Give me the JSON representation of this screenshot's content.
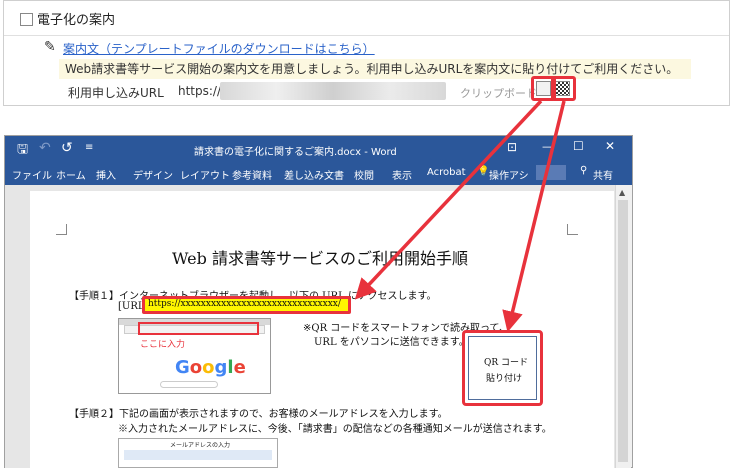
{
  "panel": {
    "section_title": "電子化の案内",
    "template_link": "案内文（テンプレートファイルのダウンロードはこちら）",
    "notice": "Web請求書等サービス開始の案内文を用意しましょう。利用申し込みURLを案内文に貼り付けてご利用ください。",
    "url_label": "利用申し込みURL",
    "url_prefix": "https://",
    "clipboard_label": "クリップボード"
  },
  "word": {
    "qat": {
      "save": "🖫",
      "undo": "↶",
      "redo": "↺",
      "more": "≡"
    },
    "title": "請求書の電子化に関するご案内.docx - Word",
    "window": {
      "ribbon_options": "⊡",
      "minimize": "—",
      "maximize": "☐",
      "close": "✕"
    },
    "menu": [
      "ファイル",
      "ホーム",
      "挿入",
      "デザイン",
      "レイアウト",
      "参考資料",
      "差し込み文書",
      "校閲",
      "表示",
      "Acrobat",
      "操作アシ"
    ],
    "share": "共有"
  },
  "doc": {
    "heading": "Web 請求書等サービスのご利用開始手順",
    "step1": "【手順１】インターネットブラウザーを起動し、以下の URL にアクセスします。",
    "url_prefix": "[URL]",
    "url_text": "https://xxxxxxxxxxxxxxxxxxxxxxxxxxxxxxx/",
    "enter_here": "ここに入力",
    "google": [
      "G",
      "o",
      "o",
      "g",
      "l",
      "e"
    ],
    "qr_note1": "※QR コードをスマートフォンで読み取って、",
    "qr_note2": "URL をパソコンに送信できます。",
    "qr_label1": "QR コード",
    "qr_label2": "貼り付け",
    "step2": "【手順２】下記の画面が表示されますので、お客様のメールアドレスを入力します。",
    "step2_note": "※入力されたメールアドレスに、今後、「請求書」の配信などの各種通知メールが送信されます。",
    "form_title": "メールアドレスの入力"
  },
  "colors": {
    "accent_red": "#e8323c",
    "word_blue": "#2b579a",
    "link_blue": "#2a62c9",
    "highlight": "#fff600"
  }
}
